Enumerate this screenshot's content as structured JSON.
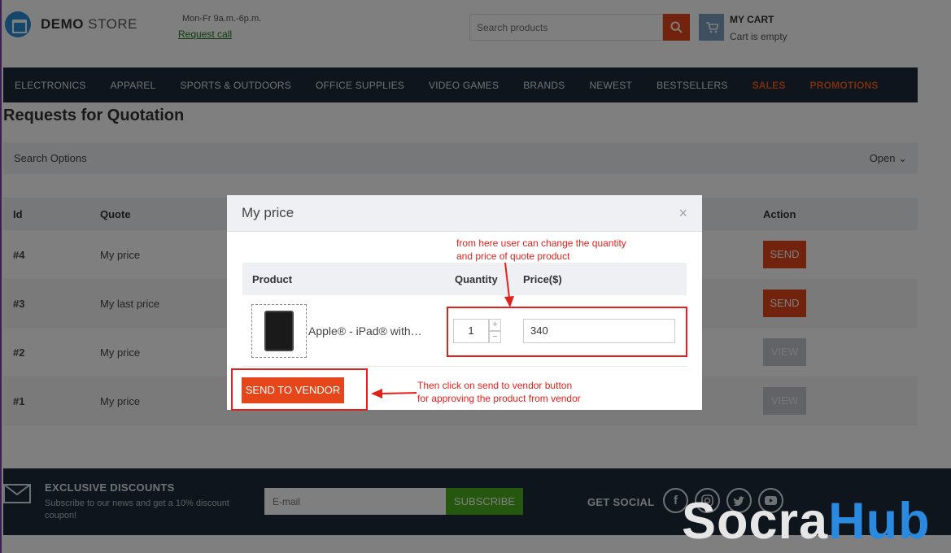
{
  "header": {
    "logo_bold": "DEMO",
    "logo_light": "STORE",
    "hours": "Mon-Fr 9a.m.-6p.m.",
    "request_call": "Request call",
    "search_placeholder": "Search products",
    "cart_title": "MY CART",
    "cart_status": "Cart is empty"
  },
  "nav": {
    "items": [
      "ELECTRONICS",
      "APPAREL",
      "SPORTS & OUTDOORS",
      "OFFICE SUPPLIES",
      "VIDEO GAMES",
      "BRANDS",
      "NEWEST",
      "BESTSELLERS",
      "SALES",
      "PROMOTIONS"
    ]
  },
  "page": {
    "title": "Requests for Quotation",
    "search_options_label": "Search Options",
    "open_toggle": "Open ⌄"
  },
  "quotes": {
    "headers": {
      "id": "Id",
      "quote": "Quote",
      "action": "Action"
    },
    "rows": [
      {
        "id": "#4",
        "quote": "My price",
        "action": "SEND"
      },
      {
        "id": "#3",
        "quote": "My last price",
        "action": "SEND"
      },
      {
        "id": "#2",
        "quote": "My price",
        "action": "VIEW"
      },
      {
        "id": "#1",
        "quote": "My price",
        "action": "VIEW"
      }
    ]
  },
  "modal": {
    "title": "My price",
    "close": "×",
    "headers": {
      "product": "Product",
      "quantity": "Quantity",
      "price": "Price($)"
    },
    "product_name": "Apple® - iPad® with…",
    "quantity": "1",
    "stepper_up": "+",
    "stepper_down": "−",
    "price": "340",
    "send_button": "SEND TO VENDOR"
  },
  "annotations": {
    "top_line1": "from here user can change the quantity",
    "top_line2": "and price of quote product",
    "bottom_line1": "Then click on send to vendor button",
    "bottom_line2": "for approving the product from vendor",
    "color": "#e3211b"
  },
  "footer": {
    "discount_title": "EXCLUSIVE DISCOUNTS",
    "discount_text": "Subscribe to our news and get a 10% discount coupon!",
    "email_placeholder": "E-mail",
    "subscribe": "SUBSCRIBE",
    "social_title": "GET SOCIAL",
    "social_icons": [
      "facebook-icon",
      "instagram-icon",
      "twitter-icon",
      "youtube-icon"
    ]
  },
  "watermark": {
    "part1": "Socra",
    "part2": "Hub"
  },
  "colors": {
    "accent": "#e5471a",
    "nav_bg": "#1f2a38",
    "subscribe": "#4caf1e",
    "brand_blue": "#2b8fd6"
  }
}
